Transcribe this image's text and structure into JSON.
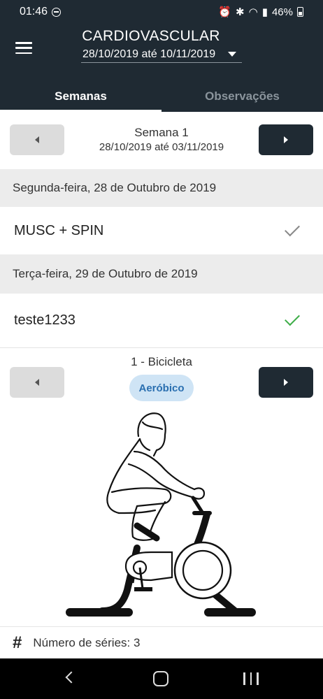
{
  "status_bar": {
    "time": "01:46",
    "battery": "46%"
  },
  "header": {
    "title": "CARDIOVASCULAR",
    "date_range": "28/10/2019 até 10/11/2019",
    "tabs": [
      {
        "label": "Semanas",
        "active": true
      },
      {
        "label": "Observações",
        "active": false
      }
    ]
  },
  "week": {
    "label": "Semana 1",
    "range": "28/10/2019 até 03/11/2019"
  },
  "days": [
    {
      "header": "Segunda-feira, 28 de Outubro de 2019",
      "workout": "MUSC + SPIN",
      "status_color": "#888888"
    },
    {
      "header": "Terça-feira, 29 de Outubro de 2019",
      "workout": "teste1233",
      "status_color": "#3fae49"
    }
  ],
  "exercise": {
    "title": "1 - Bicicleta",
    "category": "Aeróbico"
  },
  "series": {
    "label": "Número de séries: 3"
  },
  "colors": {
    "header_bg": "#1f2a33",
    "badge_bg": "#cfe4f5",
    "badge_text": "#2a6fb0",
    "check_green": "#3fae49"
  }
}
